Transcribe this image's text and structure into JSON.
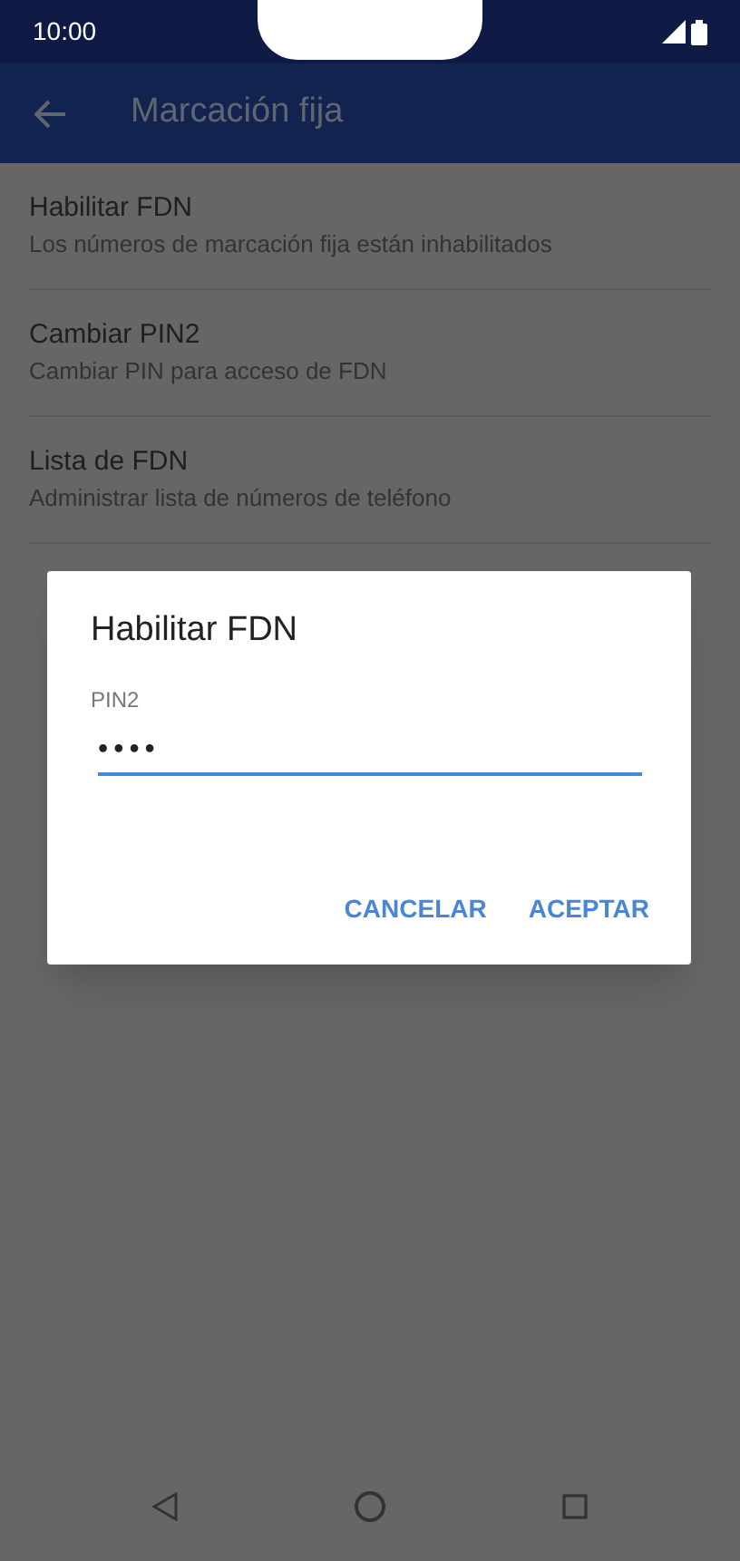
{
  "status_bar": {
    "time": "10:00"
  },
  "app_bar": {
    "title": "Marcación fija"
  },
  "items": [
    {
      "title": "Habilitar FDN",
      "subtitle": "Los números de marcación fija están inhabilitados"
    },
    {
      "title": "Cambiar PIN2",
      "subtitle": "Cambiar PIN para acceso de FDN"
    },
    {
      "title": "Lista de FDN",
      "subtitle": "Administrar lista de números de teléfono"
    }
  ],
  "dialog": {
    "title": "Habilitar FDN",
    "field_label": "PIN2",
    "value": "••••",
    "buttons": [
      "CANCELAR",
      "ACEPTAR"
    ]
  }
}
